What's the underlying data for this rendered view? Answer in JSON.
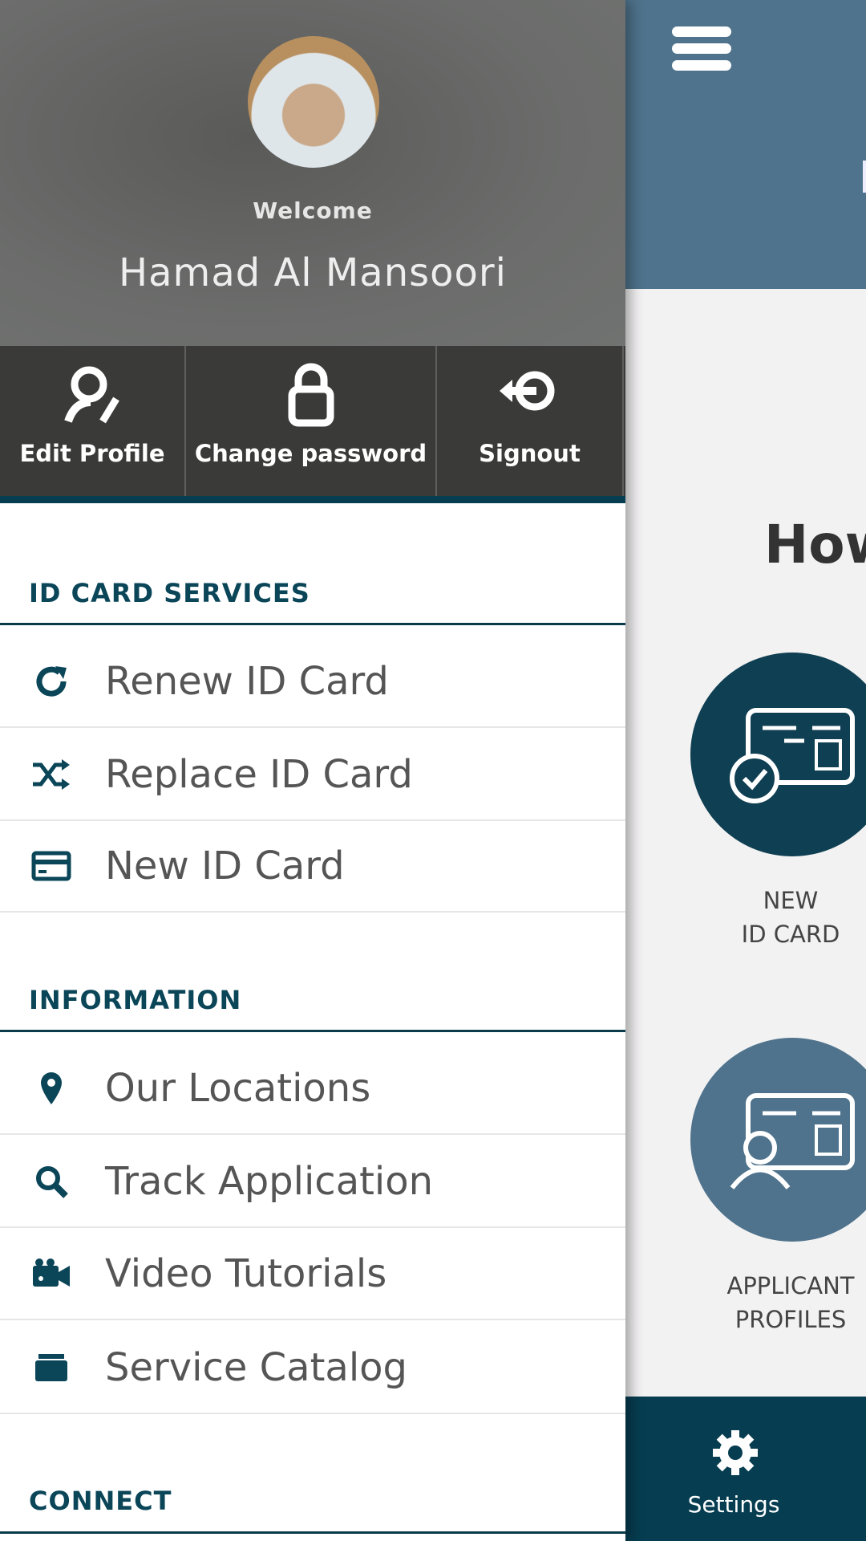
{
  "profile": {
    "welcome": "Welcome",
    "name": "Hamad Al Mansoori"
  },
  "actions": [
    {
      "label": "Edit  Profile",
      "icon": "user-edit-icon"
    },
    {
      "label": "Change  password",
      "icon": "lock-icon"
    },
    {
      "label": "Signout",
      "icon": "signout-icon"
    }
  ],
  "sections": [
    {
      "title": "ID CARD SERVICES",
      "items": [
        {
          "label": "Renew ID Card",
          "icon": "refresh-icon"
        },
        {
          "label": "Replace ID Card",
          "icon": "shuffle-icon"
        },
        {
          "label": "New ID Card",
          "icon": "credit-card-icon"
        }
      ]
    },
    {
      "title": "INFORMATION",
      "items": [
        {
          "label": "Our Locations",
          "icon": "map-pin-icon"
        },
        {
          "label": "Track Application",
          "icon": "search-icon"
        },
        {
          "label": "Video Tutorials",
          "icon": "video-camera-icon"
        },
        {
          "label": "Service Catalog",
          "icon": "folder-icon"
        }
      ]
    },
    {
      "title": "CONNECT",
      "items": []
    }
  ],
  "main": {
    "heading": "How",
    "cards": [
      {
        "line1": "NEW",
        "line2": "ID CARD",
        "color": "#0f3f52"
      },
      {
        "line1": "APPLICANT",
        "line2": "PROFILES",
        "color": "#4f738c"
      }
    ],
    "bottom_nav": {
      "label": "Settings",
      "icon": "gear-icon"
    }
  },
  "colors": {
    "header": "#4f738c",
    "accent": "#063d50"
  }
}
